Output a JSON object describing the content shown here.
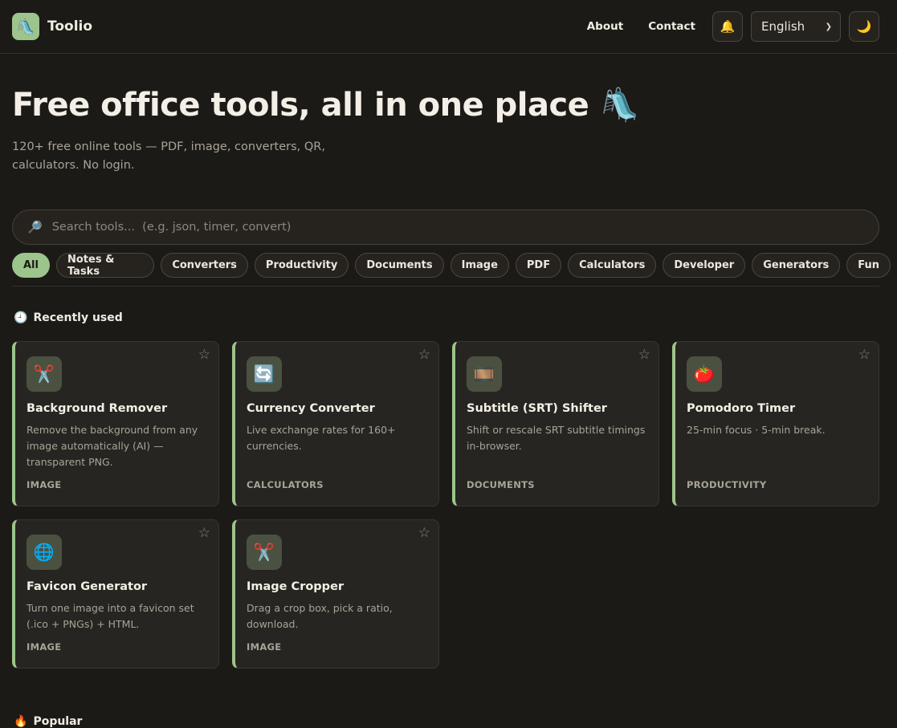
{
  "header": {
    "brand": "Toolio",
    "logo_emoji": "🛝",
    "nav": {
      "about": "About",
      "contact": "Contact"
    },
    "notify_icon": "🔔",
    "language": "English",
    "theme_icon": "🌙"
  },
  "hero": {
    "title": "Free office tools, all in one place 🛝",
    "subtitle": "120+ free online tools — PDF, image, converters, QR, calculators. No login."
  },
  "search": {
    "icon": "🔎",
    "placeholder": "Search tools...  (e.g. json, timer, convert)"
  },
  "categories": [
    "All",
    "Notes & Tasks",
    "Converters",
    "Productivity",
    "Documents",
    "Image",
    "PDF",
    "Calculators",
    "Developer",
    "Generators",
    "Fun"
  ],
  "sections": {
    "recent": {
      "icon": "🕘",
      "label": "Recently used"
    },
    "popular": {
      "icon": "🔥",
      "label": "Popular"
    }
  },
  "star_glyph": "☆",
  "recent_tools": [
    {
      "icon": "✂️",
      "title": "Background Remover",
      "desc": "Remove the background from any image automatically (AI) — transparent PNG.",
      "category": "IMAGE"
    },
    {
      "icon": "🔄",
      "title": "Currency Converter",
      "desc": "Live exchange rates for 160+ currencies.",
      "category": "CALCULATORS"
    },
    {
      "icon": "🎞️",
      "title": "Subtitle (SRT) Shifter",
      "desc": "Shift or rescale SRT subtitle timings in-browser.",
      "category": "DOCUMENTS"
    },
    {
      "icon": "🍅",
      "title": "Pomodoro Timer",
      "desc": "25-min focus · 5-min break.",
      "category": "PRODUCTIVITY"
    },
    {
      "icon": "🌐",
      "title": "Favicon Generator",
      "desc": "Turn one image into a favicon set (.ico + PNGs) + HTML.",
      "category": "IMAGE"
    },
    {
      "icon": "✂️",
      "title": "Image Cropper",
      "desc": "Drag a crop box, pick a ratio, download.",
      "category": "IMAGE"
    }
  ]
}
